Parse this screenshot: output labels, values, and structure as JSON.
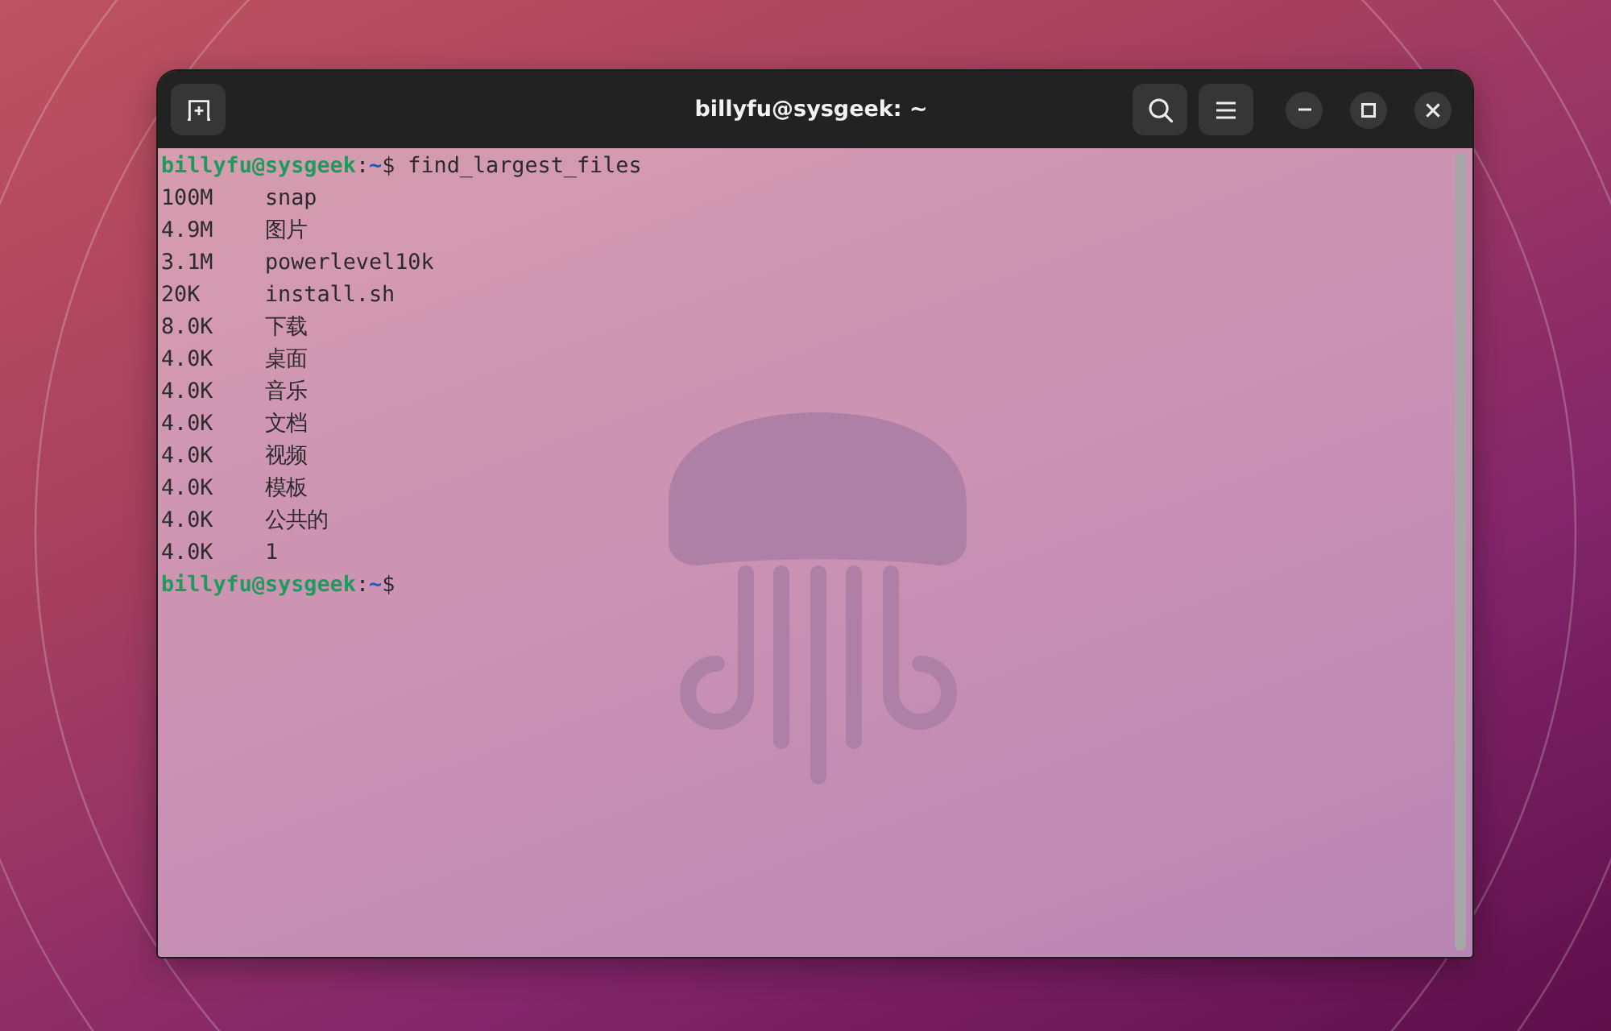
{
  "window": {
    "title": "billyfu@sysgeek: ~"
  },
  "terminal": {
    "lines": [
      {
        "kind": "prompt",
        "prompt": {
          "user_host": "billyfu@sysgeek",
          "separator": ":",
          "cwd": "~",
          "symbol": "$"
        },
        "command": "find_largest_files"
      },
      {
        "kind": "output",
        "size": "100M",
        "name": "snap"
      },
      {
        "kind": "output",
        "size": "4.9M",
        "name": "图片"
      },
      {
        "kind": "output",
        "size": "3.1M",
        "name": "powerlevel10k"
      },
      {
        "kind": "output",
        "size": "20K",
        "name": "install.sh"
      },
      {
        "kind": "output",
        "size": "8.0K",
        "name": "下载"
      },
      {
        "kind": "output",
        "size": "4.0K",
        "name": "桌面"
      },
      {
        "kind": "output",
        "size": "4.0K",
        "name": "音乐"
      },
      {
        "kind": "output",
        "size": "4.0K",
        "name": "文档"
      },
      {
        "kind": "output",
        "size": "4.0K",
        "name": "视频"
      },
      {
        "kind": "output",
        "size": "4.0K",
        "name": "模板"
      },
      {
        "kind": "output",
        "size": "4.0K",
        "name": "公共的"
      },
      {
        "kind": "output",
        "size": "4.0K",
        "name": "1"
      },
      {
        "kind": "prompt",
        "prompt": {
          "user_host": "billyfu@sysgeek",
          "separator": ":",
          "cwd": "~",
          "symbol": "$"
        }
      }
    ]
  }
}
